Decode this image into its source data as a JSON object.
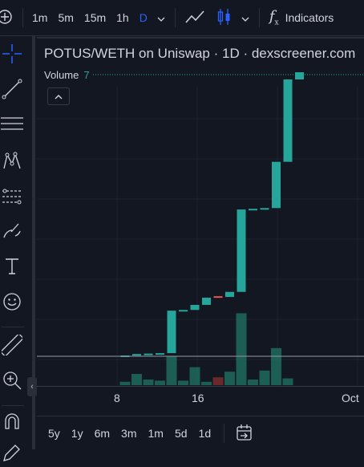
{
  "toolbar": {
    "intervals": [
      "1m",
      "5m",
      "15m",
      "1h",
      "D"
    ],
    "active_interval": "D",
    "indicators_label": "Indicators",
    "icons": [
      "add-icon",
      "chevron-down-icon",
      "line-chart-icon",
      "candles-icon",
      "chevron-down-icon",
      "function-icon"
    ]
  },
  "sidebar": {
    "tools": [
      "crosshair-icon",
      "trend-line-icon",
      "fib-lines-icon",
      "pattern-icon",
      "channel-icon",
      "brush-icon",
      "text-icon",
      "emoji-icon",
      "ruler-icon",
      "zoom-icon",
      "magnet-icon",
      "lock-pencil-icon"
    ]
  },
  "chart": {
    "title": "POTUS/WETH on Uniswap · 1D · dexscreener.com",
    "volume_label": "Volume",
    "volume_value": "7"
  },
  "chart_data": {
    "type": "candlestick",
    "x_tick_labels": [
      "8",
      "16",
      "Oct"
    ],
    "x": [
      7,
      8,
      9,
      10,
      11,
      12,
      13,
      14,
      15,
      16,
      17,
      18,
      19,
      20,
      21,
      22
    ],
    "candles": [
      {
        "open": 0.9,
        "close": 0.9,
        "dir": "up"
      },
      {
        "open": 0.9,
        "close": 1.0,
        "dir": "up"
      },
      {
        "open": 1.0,
        "close": 1.03,
        "dir": "up"
      },
      {
        "open": 1.03,
        "close": 1.06,
        "dir": "up"
      },
      {
        "open": 1.06,
        "close": 4.0,
        "dir": "up"
      },
      {
        "open": 4.0,
        "close": 4.05,
        "dir": "up"
      },
      {
        "open": 4.05,
        "close": 4.4,
        "dir": "up"
      },
      {
        "open": 4.4,
        "close": 4.9,
        "dir": "up"
      },
      {
        "open": 5.0,
        "close": 4.95,
        "dir": "down"
      },
      {
        "open": 4.95,
        "close": 5.3,
        "dir": "up"
      },
      {
        "open": 5.3,
        "close": 11.0,
        "dir": "up"
      },
      {
        "open": 11.0,
        "close": 11.05,
        "dir": "up"
      },
      {
        "open": 11.05,
        "close": 11.1,
        "dir": "up"
      },
      {
        "open": 11.1,
        "close": 14.3,
        "dir": "up"
      },
      {
        "open": 14.3,
        "close": 20.0,
        "dir": "up"
      },
      {
        "open": 20.0,
        "close": 20.5,
        "dir": "up"
      }
    ],
    "volume": [
      0.3,
      1.0,
      0.5,
      0.4,
      2.6,
      0.4,
      1.6,
      0.3,
      0.7,
      1.2,
      6.4,
      0.5,
      1.3,
      3.3,
      0.6,
      0
    ],
    "grid": true,
    "up_color": "#26a69a",
    "down_color": "#ef5350"
  },
  "time_axis": {
    "labels": [
      "8",
      "16",
      "Oct"
    ]
  },
  "bottombar": {
    "ranges": [
      "5y",
      "1y",
      "6m",
      "3m",
      "1m",
      "5d",
      "1d"
    ],
    "icons": [
      "goto-date-icon"
    ]
  }
}
